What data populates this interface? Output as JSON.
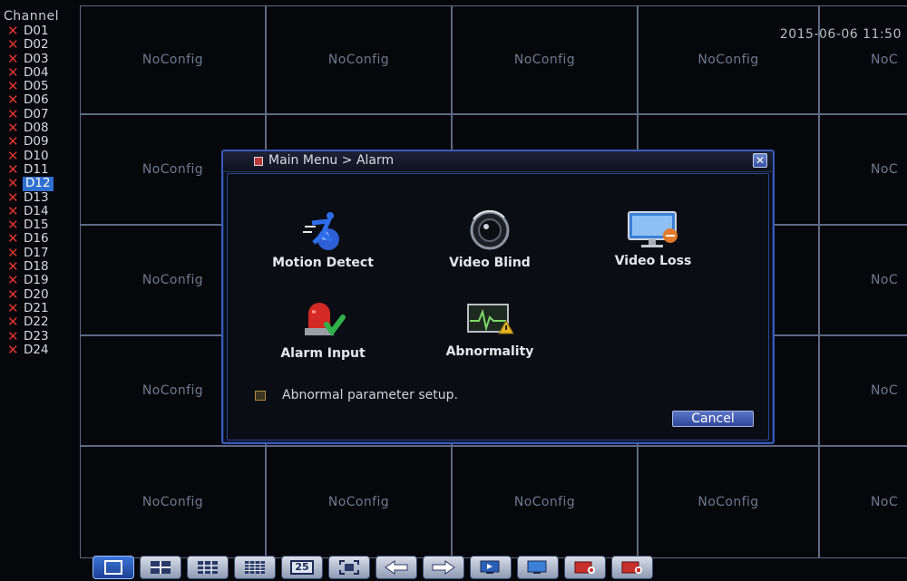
{
  "channels": {
    "header": "Channel",
    "items": [
      "D01",
      "D02",
      "D03",
      "D04",
      "D05",
      "D06",
      "D07",
      "D08",
      "D09",
      "D10",
      "D11",
      "D12",
      "D13",
      "D14",
      "D15",
      "D16",
      "D17",
      "D18",
      "D19",
      "D20",
      "D21",
      "D22",
      "D23",
      "D24"
    ],
    "selected": "D12",
    "status_icon": "x-icon"
  },
  "timestamp": "2015-06-06 11:50",
  "grid": {
    "cell_label": "NoConfig",
    "partial_label": "NoC"
  },
  "dialog": {
    "title": "Main Menu > Alarm",
    "close_icon": "close-icon",
    "items": [
      {
        "label": "Motion Detect",
        "icon": "running-man-icon"
      },
      {
        "label": "Video Blind",
        "icon": "camera-lens-icon"
      },
      {
        "label": "Video Loss",
        "icon": "monitor-icon"
      },
      {
        "label": "Alarm Input",
        "icon": "siren-icon"
      },
      {
        "label": "Abnormality",
        "icon": "warning-monitor-icon"
      }
    ],
    "status_text": "Abnormal parameter setup.",
    "cancel_label": "Cancel"
  },
  "toolbar": {
    "buttons": [
      "single-view-icon",
      "quad-view-icon",
      "nine-view-icon",
      "sixteen-view-icon",
      "twenty-five-view-icon",
      "fullscreen-icon",
      "previous-icon",
      "next-icon",
      "playback-icon",
      "monitor-icon",
      "record-icon",
      "stop-record-icon"
    ],
    "twenty_five_label": "25"
  },
  "colors": {
    "accent": "#2f6fd0",
    "alarm_red": "#e0332d",
    "grid_line": "#5d6a86"
  }
}
